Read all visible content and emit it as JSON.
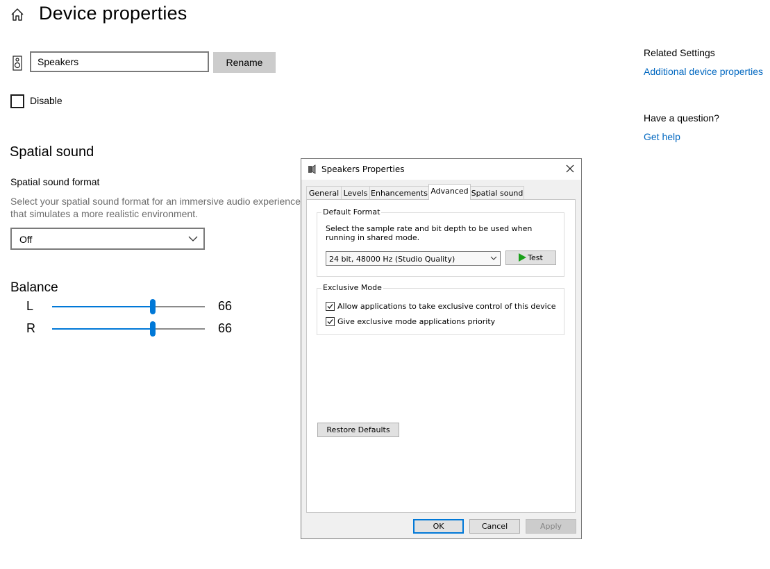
{
  "page": {
    "title": "Device properties",
    "device_name_value": "Speakers",
    "rename_label": "Rename",
    "disable_label": "Disable",
    "disable_checked": false
  },
  "spatial_sound": {
    "section_title": "Spatial sound",
    "format_label": "Spatial sound format",
    "description": "Select your spatial sound format for an immersive audio experience that simulates a more realistic environment.",
    "format_value": "Off"
  },
  "balance": {
    "title": "Balance",
    "channels": [
      {
        "label": "L",
        "value": "66",
        "level": 66
      },
      {
        "label": "R",
        "value": "66",
        "level": 66
      }
    ]
  },
  "related": {
    "title": "Related Settings",
    "link": "Additional device properties",
    "question_title": "Have a question?",
    "help_link": "Get help"
  },
  "dialog": {
    "title": "Speakers Properties",
    "tabs": [
      {
        "label": "General",
        "active": false
      },
      {
        "label": "Levels",
        "active": false
      },
      {
        "label": "Enhancements",
        "active": false
      },
      {
        "label": "Advanced",
        "active": true
      },
      {
        "label": "Spatial sound",
        "active": false
      }
    ],
    "default_format": {
      "title": "Default Format",
      "description": "Select the sample rate and bit depth to be used when running in shared mode.",
      "selected_format": "24 bit, 48000 Hz (Studio Quality)",
      "test_label": "Test"
    },
    "exclusive_mode": {
      "title": "Exclusive Mode",
      "options": [
        {
          "label": "Allow applications to take exclusive control of this device",
          "checked": true
        },
        {
          "label": "Give exclusive mode applications priority",
          "checked": true
        }
      ]
    },
    "restore_label": "Restore Defaults",
    "buttons": {
      "ok": "OK",
      "cancel": "Cancel",
      "apply": "Apply"
    }
  },
  "colors": {
    "accent": "#0078d7",
    "link": "#0067c0",
    "muted_text": "#6b6b6b",
    "play_green": "#1aa01a"
  },
  "icons": [
    "home-icon",
    "speaker-icon",
    "chevron-down-icon",
    "close-icon",
    "play-icon",
    "checkmark-icon"
  ]
}
